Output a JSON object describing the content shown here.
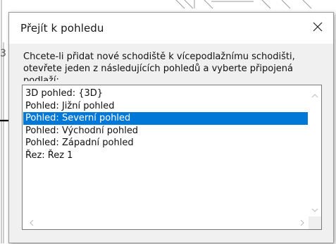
{
  "dialog": {
    "title": "Přejít k pohledu",
    "message": "Chcete-li přidat nové schodiště k vícepodlažnímu schodišti, otevřete jeden z následujících pohledů a vyberte připojená podlaží:",
    "close_icon": "close-icon"
  },
  "views_list": {
    "items": [
      {
        "label": "3D pohled: {3D}",
        "selected": false
      },
      {
        "label": "Pohled: Jižní pohled",
        "selected": false
      },
      {
        "label": "Pohled: Severní pohled",
        "selected": true
      },
      {
        "label": "Pohled: Východní pohled",
        "selected": false
      },
      {
        "label": "Pohled: Západní pohled",
        "selected": false
      },
      {
        "label": "Řez: Řez 1",
        "selected": false
      }
    ],
    "selection_color": "#0078d7"
  },
  "annotation": {
    "arrow_icon": "arrow-right-icon"
  }
}
